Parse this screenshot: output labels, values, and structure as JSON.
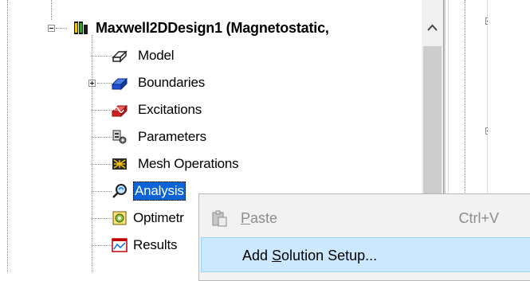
{
  "tree": {
    "root": {
      "label": "Maxwell2DDesign1 (Magnetostatic,",
      "icon": "maxwell-design-icon"
    },
    "items": [
      {
        "label": "Model",
        "icon": "model-icon",
        "expander": false
      },
      {
        "label": "Boundaries",
        "icon": "boundaries-icon",
        "expander": true
      },
      {
        "label": "Excitations",
        "icon": "excitations-icon",
        "expander": false
      },
      {
        "label": "Parameters",
        "icon": "parameters-icon",
        "expander": false
      },
      {
        "label": "Mesh Operations",
        "icon": "mesh-operations-icon",
        "expander": false
      },
      {
        "label": "Analysis",
        "icon": "analysis-icon",
        "expander": false,
        "selected": true
      },
      {
        "label": "Optimetr",
        "icon": "optimetrics-icon",
        "expander": false
      },
      {
        "label": "Results",
        "icon": "results-icon",
        "expander": false
      }
    ]
  },
  "scrollbar": {
    "up_arrow": "^"
  },
  "context_menu": {
    "items": [
      {
        "label_pre": "",
        "mnemonic": "P",
        "label_post": "aste",
        "shortcut": "Ctrl+V",
        "icon": "paste-icon",
        "disabled": true
      },
      {
        "label_pre": "Add ",
        "mnemonic": "S",
        "label_post": "olution Setup...",
        "shortcut": "",
        "icon": "",
        "disabled": false,
        "hover": true
      }
    ]
  },
  "colors": {
    "selection": "#0a64d8",
    "menu_hover": "#cce8ff",
    "menu_bg": "#f2f2f2",
    "scroll_thumb": "#cdcdcd"
  }
}
